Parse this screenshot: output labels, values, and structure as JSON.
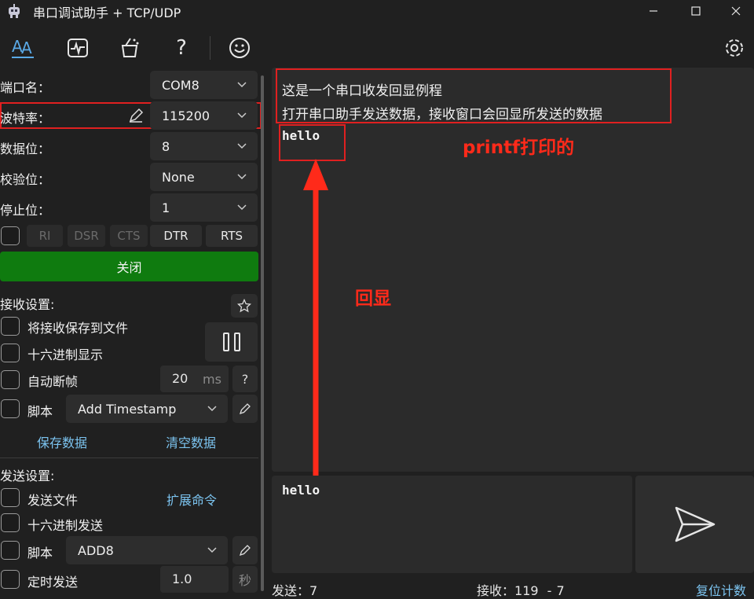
{
  "window": {
    "title": "串口调试助手 + TCP/UDP",
    "app_icon": "robot-icon"
  },
  "toolbar": {
    "icons": [
      "text-format-icon",
      "waveform-icon",
      "magic-icon",
      "help-icon",
      "smile-icon"
    ],
    "settings_icon": "gear-icon"
  },
  "port": {
    "port_label": "端口名：",
    "port_value": "COM8",
    "baud_label": "波特率：",
    "baud_value": "115200",
    "databits_label": "数据位：",
    "databits_value": "8",
    "parity_label": "校验位：",
    "parity_value": "None",
    "stopbits_label": "停止位：",
    "stopbits_value": "1",
    "pins": [
      "RI",
      "DSR",
      "CTS",
      "DTR",
      "RTS"
    ],
    "open_button": "关闭",
    "accent": "#0f7b0f"
  },
  "receive": {
    "title": "接收设置:",
    "save_to_file": "将接收保存到文件",
    "hex_display": "十六进制显示",
    "auto_frame": "自动断帧",
    "frame_value": "20",
    "frame_unit": "ms",
    "help": "?",
    "script_label": "脚本",
    "script_value": "Add Timestamp",
    "save_data": "保存数据",
    "clear_data": "清空数据"
  },
  "send": {
    "title": "发送设置:",
    "send_file": "发送文件",
    "ext_cmd": "扩展命令",
    "hex_send": "十六进制发送",
    "script_label": "脚本",
    "script_value": "ADD8",
    "timed_send": "定时发送",
    "interval_value": "1.0",
    "interval_unit": "秒",
    "input_text": "hello"
  },
  "receive_window": {
    "line1": "这是一个串口收发回显例程",
    "line2": "打开串口助手发送数据，接收窗口会回显所发送的数据",
    "echo": "hello"
  },
  "annotations": {
    "printf_note": "printf打印的",
    "echo_note": "回显",
    "color": "#ff2a1a"
  },
  "status": {
    "sent_label": "发送：",
    "sent_count": "7",
    "recv_label": "接收：",
    "recv_count": "119",
    "recv_sep": "-",
    "recv_extra": "7",
    "reset": "复位计数"
  }
}
